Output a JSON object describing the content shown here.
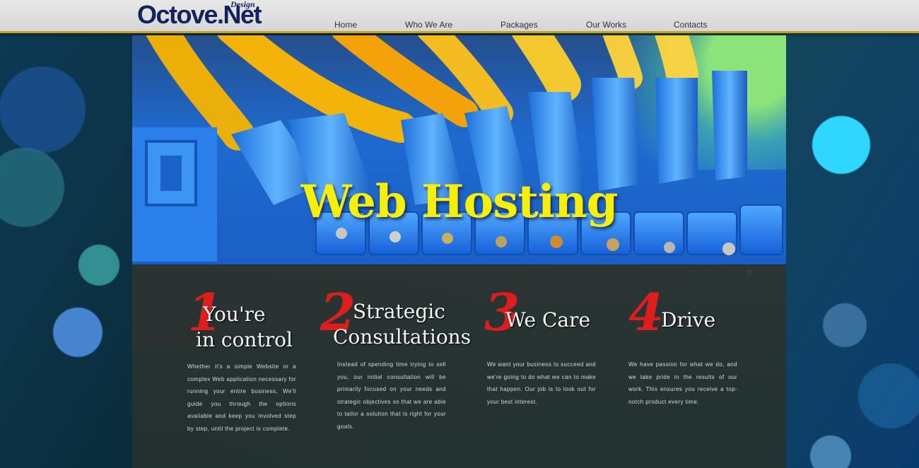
{
  "brand": {
    "name": "Octove.Net",
    "tagline": "Design",
    "color": "#14225c"
  },
  "nav": {
    "items": [
      {
        "label": "Home"
      },
      {
        "label": "Who We Are"
      },
      {
        "label": "Packages"
      },
      {
        "label": "Our Works"
      },
      {
        "label": "Contacts"
      }
    ],
    "accent_color": "#c9a21b"
  },
  "hero": {
    "title": "Web Hosting",
    "title_color": "#f7f000",
    "slide_count": 5,
    "active_slide": 4
  },
  "features": [
    {
      "number": "1",
      "title_line1": "You're",
      "title_line2": "in control",
      "body": "Whether it's a simple Website or a complex Web application necessary for running your entire business, We'll guide you through the options available and keep you involved step by step, until the project is complete."
    },
    {
      "number": "2",
      "title_line1": "Strategic",
      "title_line2": "Consultations",
      "body": "Instead of spending time trying to sell you, our initial consultation will be primarily focused on your needs and strategic objectives so that we are able to tailor a solution that is right for your goals."
    },
    {
      "number": "3",
      "title_line1": "We Care",
      "title_line2": "",
      "body": "We want your business to succeed and we're going to do what we can to make that happen. Our job is to look out for your best interest."
    },
    {
      "number": "4",
      "title_line1": "Drive",
      "title_line2": "",
      "body": "We have passion for what we do, and we take pride in the results of our work. This ensures you receive a top-notch product every time."
    }
  ],
  "number_color": "#e01d1d"
}
